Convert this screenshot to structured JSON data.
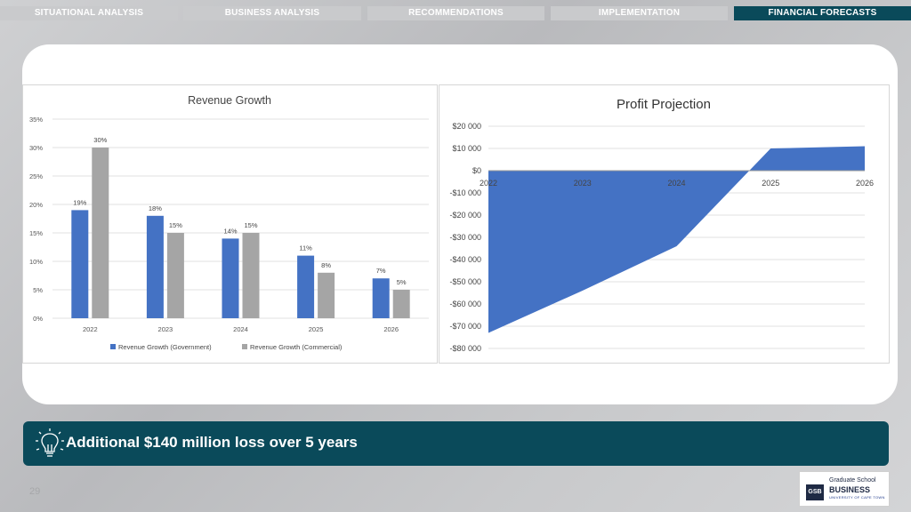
{
  "nav": {
    "tabs": [
      "SITUATIONAL ANALYSIS",
      "BUSINESS ANALYSIS",
      "RECOMMENDATIONS",
      "IMPLEMENTATION",
      "FINANCIAL FORECASTS"
    ],
    "active_index": 4
  },
  "colors": {
    "active_tab": "#0a4a5a",
    "government": "#4472c4",
    "commercial": "#a5a5a5",
    "profit": "#4472c4"
  },
  "banner": {
    "text": "Additional $140 million loss over 5 years",
    "icon": "lightbulb-icon"
  },
  "page_number": "29",
  "logo": {
    "line1": "Graduate School",
    "line2": "BUSINESS",
    "line3": "UNIVERSITY OF CAPE TOWN",
    "mark": "GSB"
  },
  "chart_data": [
    {
      "type": "bar",
      "title": "Revenue Growth",
      "categories": [
        "2022",
        "2023",
        "2024",
        "2025",
        "2026"
      ],
      "series": [
        {
          "name": "Revenue Growth (Government)",
          "values": [
            19,
            18,
            14,
            11,
            7
          ],
          "labels": [
            "19%",
            "18%",
            "14%",
            "11%",
            "7%"
          ]
        },
        {
          "name": "Revenue Growth (Commercial)",
          "values": [
            30,
            15,
            15,
            8,
            5
          ],
          "labels": [
            "30%",
            "15%",
            "15%",
            "8%",
            "5%"
          ]
        }
      ],
      "ylim": [
        0,
        35
      ],
      "yticks": [
        "0%",
        "5%",
        "10%",
        "15%",
        "20%",
        "25%",
        "30%",
        "35%"
      ],
      "legend": "bottom",
      "grid": true
    },
    {
      "type": "area",
      "title": "Profit Projection",
      "x": [
        "2022",
        "2023",
        "2024",
        "2025",
        "2026"
      ],
      "values": [
        -73000,
        -54000,
        -34000,
        10000,
        11000
      ],
      "ylim": [
        -80000,
        20000
      ],
      "yticks": [
        "$20 000",
        "$10 000",
        "$0",
        "-$10 000",
        "-$20 000",
        "-$30 000",
        "-$40 000",
        "-$50 000",
        "-$60 000",
        "-$70 000",
        "-$80 000"
      ],
      "grid": true
    }
  ]
}
